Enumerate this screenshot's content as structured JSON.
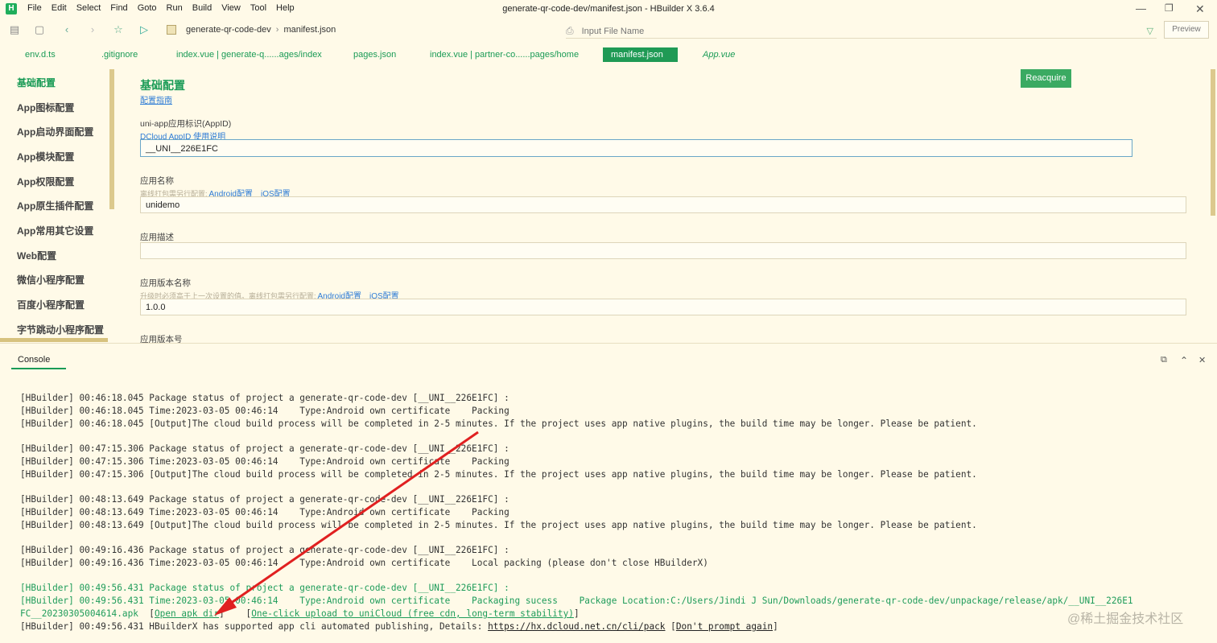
{
  "window": {
    "title": "generate-qr-code-dev/manifest.json - HBuilder X 3.6.4",
    "logo_letter": "H",
    "menu": [
      "File",
      "Edit",
      "Select",
      "Find",
      "Goto",
      "Run",
      "Build",
      "View",
      "Tool",
      "Help"
    ]
  },
  "toolbar": {
    "breadcrumb": [
      "generate-qr-code-dev",
      "manifest.json"
    ],
    "file_search_placeholder": "Input File Name",
    "preview_label": "Preview"
  },
  "tabs": [
    {
      "label": "env.d.ts"
    },
    {
      "label": ".gitignore"
    },
    {
      "label": "index.vue | generate-q......ages/index"
    },
    {
      "label": "pages.json"
    },
    {
      "label": "index.vue | partner-co......pages/home"
    },
    {
      "label": "manifest.json",
      "active": true
    },
    {
      "label": "App.vue"
    }
  ],
  "sidebar": {
    "items": [
      {
        "label": "基础配置",
        "active": true
      },
      {
        "label": "App图标配置"
      },
      {
        "label": "App启动界面配置"
      },
      {
        "label": "App模块配置"
      },
      {
        "label": "App权限配置"
      },
      {
        "label": "App原生插件配置"
      },
      {
        "label": "App常用其它设置"
      },
      {
        "label": "Web配置"
      },
      {
        "label": "微信小程序配置"
      },
      {
        "label": "百度小程序配置"
      },
      {
        "label": "字节跳动小程序配置"
      }
    ]
  },
  "form": {
    "section_title": "基础配置",
    "guide_link": "配置指南",
    "appid": {
      "label": "uni-app应用标识(AppID)",
      "help_link": "DCloud AppID 使用说明",
      "value": "__UNI__226E1FC",
      "button": "Reacquire"
    },
    "app_name": {
      "label": "应用名称",
      "hint": "离线打包需另行配置:",
      "android_link": "Android配置",
      "ios_link": "iOS配置",
      "value": "unidemo"
    },
    "app_desc": {
      "label": "应用描述",
      "value": ""
    },
    "version_name": {
      "label": "应用版本名称",
      "hint": "升级时必须高于上一次设置的值。离线打包需另行配置:",
      "android_link": "Android配置",
      "ios_link": "iOS配置",
      "value": "1.0.0"
    },
    "version_code": {
      "label": "应用版本号"
    }
  },
  "console": {
    "tab_label": "Console",
    "lines": [
      "[HBuilder] 00:46:18.045 Package status of project a generate-qr-code-dev [__UNI__226E1FC] :",
      "[HBuilder] 00:46:18.045 Time:2023-03-05 00:46:14    Type:Android own certificate    Packing",
      "[HBuilder] 00:46:18.045 [Output]The cloud build process will be completed in 2-5 minutes. If the project uses app native plugins, the build time may be longer. Please be patient.",
      "[HBuilder] 00:47:15.306 Package status of project a generate-qr-code-dev [__UNI__226E1FC] :",
      "[HBuilder] 00:47:15.306 Time:2023-03-05 00:46:14    Type:Android own certificate    Packing",
      "[HBuilder] 00:47:15.306 [Output]The cloud build process will be completed in 2-5 minutes. If the project uses app native plugins, the build time may be longer. Please be patient.",
      "[HBuilder] 00:48:13.649 Package status of project a generate-qr-code-dev [__UNI__226E1FC] :",
      "[HBuilder] 00:48:13.649 Time:2023-03-05 00:46:14    Type:Android own certificate    Packing",
      "[HBuilder] 00:48:13.649 [Output]The cloud build process will be completed in 2-5 minutes. If the project uses app native plugins, the build time may be longer. Please be patient.",
      "[HBuilder] 00:49:16.436 Package status of project a generate-qr-code-dev [__UNI__226E1FC] :",
      "[HBuilder] 00:49:16.436 Time:2023-03-05 00:46:14    Type:Android own certificate    Local packing (please don't close HBuilderX)",
      "[HBuilder] 00:49:56.431 Package status of project a generate-qr-code-dev [__UNI__226E1FC] :",
      "[HBuilder] 00:49:56.431 Time:2023-03-05 00:46:14    Type:Android own certificate    Packaging sucess    Package Location:C:/Users/Jindi J Sun/Downloads/generate-qr-code-dev/unpackage/release/apk/__UNI__226E1",
      "FC__20230305004614.apk"
    ],
    "open_apk_dir": "Open apk dir",
    "upload_unicloud": "One-click upload to uniCloud (free cdn, long-term stability)",
    "last_line_prefix": "[HBuilder] 00:49:56.431 HBuilderX has supported app cli automated publishing, Details: ",
    "cli_link": "https://hx.dcloud.net.cn/cli/pack",
    "dont_prompt": "Don't prompt again"
  },
  "watermark": "@稀土掘金技术社区",
  "colors": {
    "accent": "#1f9a55",
    "background": "#fffae8",
    "link": "#2e7cd6",
    "arrow": "#e02020"
  }
}
